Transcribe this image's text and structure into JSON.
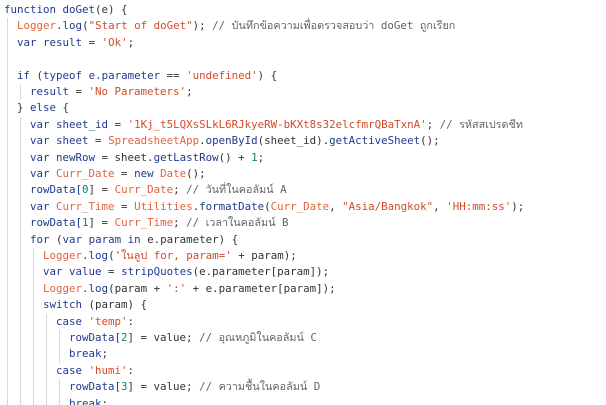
{
  "editor": {
    "lines": [
      [
        {
          "t": "function ",
          "c": "kw"
        },
        {
          "t": "doGet",
          "c": "fn"
        },
        {
          "t": "(e) {",
          "c": "op"
        }
      ],
      [
        {
          "t": "  ",
          "c": "op"
        },
        {
          "t": "Logger",
          "c": "obj"
        },
        {
          "t": ".",
          "c": "op"
        },
        {
          "t": "log",
          "c": "fn"
        },
        {
          "t": "(",
          "c": "op"
        },
        {
          "t": "\"Start of doGet\"",
          "c": "str"
        },
        {
          "t": "); ",
          "c": "op"
        },
        {
          "t": "// บันทึกข้อความเพื่อตรวจสอบว่า doGet ถูกเรียก",
          "c": "cm"
        }
      ],
      [
        {
          "t": "  ",
          "c": "op"
        },
        {
          "t": "var ",
          "c": "kw"
        },
        {
          "t": "result",
          "c": "id"
        },
        {
          "t": " = ",
          "c": "op"
        },
        {
          "t": "'Ok'",
          "c": "str"
        },
        {
          "t": ";",
          "c": "op"
        }
      ],
      [
        {
          "t": "",
          "c": "op"
        }
      ],
      [
        {
          "t": "  ",
          "c": "op"
        },
        {
          "t": "if ",
          "c": "kw"
        },
        {
          "t": "(",
          "c": "op"
        },
        {
          "t": "typeof ",
          "c": "kw"
        },
        {
          "t": "e.parameter",
          "c": "id"
        },
        {
          "t": " == ",
          "c": "op"
        },
        {
          "t": "'undefined'",
          "c": "str"
        },
        {
          "t": ") {",
          "c": "op"
        }
      ],
      [
        {
          "t": "    ",
          "c": "op"
        },
        {
          "t": "result",
          "c": "id"
        },
        {
          "t": " = ",
          "c": "op"
        },
        {
          "t": "'No Parameters'",
          "c": "str"
        },
        {
          "t": ";",
          "c": "op"
        }
      ],
      [
        {
          "t": "  } ",
          "c": "op"
        },
        {
          "t": "else ",
          "c": "kw"
        },
        {
          "t": "{",
          "c": "op"
        }
      ],
      [
        {
          "t": "    ",
          "c": "op"
        },
        {
          "t": "var ",
          "c": "kw"
        },
        {
          "t": "sheet_id",
          "c": "id"
        },
        {
          "t": " = ",
          "c": "op"
        },
        {
          "t": "'1Kj_t5LQXsSLkL6RJkyeRW-bKXt8s32elcfmrQBaTxnA'",
          "c": "str"
        },
        {
          "t": "; ",
          "c": "op"
        },
        {
          "t": "// รหัสสเปรดชีท",
          "c": "cm"
        }
      ],
      [
        {
          "t": "    ",
          "c": "op"
        },
        {
          "t": "var ",
          "c": "kw"
        },
        {
          "t": "sheet",
          "c": "id"
        },
        {
          "t": " = ",
          "c": "op"
        },
        {
          "t": "SpreadsheetApp",
          "c": "obj"
        },
        {
          "t": ".",
          "c": "op"
        },
        {
          "t": "openById",
          "c": "fn"
        },
        {
          "t": "(sheet_id).",
          "c": "op"
        },
        {
          "t": "getActiveSheet",
          "c": "fn"
        },
        {
          "t": "();",
          "c": "op"
        }
      ],
      [
        {
          "t": "    ",
          "c": "op"
        },
        {
          "t": "var ",
          "c": "kw"
        },
        {
          "t": "newRow",
          "c": "id"
        },
        {
          "t": " = sheet.",
          "c": "op"
        },
        {
          "t": "getLastRow",
          "c": "fn"
        },
        {
          "t": "() + ",
          "c": "op"
        },
        {
          "t": "1",
          "c": "num"
        },
        {
          "t": ";",
          "c": "op"
        }
      ],
      [
        {
          "t": "    ",
          "c": "op"
        },
        {
          "t": "var ",
          "c": "kw"
        },
        {
          "t": "Curr_Date",
          "c": "var"
        },
        {
          "t": " = ",
          "c": "op"
        },
        {
          "t": "new ",
          "c": "kw"
        },
        {
          "t": "Date",
          "c": "obj"
        },
        {
          "t": "();",
          "c": "op"
        }
      ],
      [
        {
          "t": "    ",
          "c": "op"
        },
        {
          "t": "rowData[",
          "c": "id"
        },
        {
          "t": "0",
          "c": "num"
        },
        {
          "t": "] = ",
          "c": "op"
        },
        {
          "t": "Curr_Date",
          "c": "var"
        },
        {
          "t": "; ",
          "c": "op"
        },
        {
          "t": "// วันที่ในคอลัมน์ A",
          "c": "cm"
        }
      ],
      [
        {
          "t": "    ",
          "c": "op"
        },
        {
          "t": "var ",
          "c": "kw"
        },
        {
          "t": "Curr_Time",
          "c": "var"
        },
        {
          "t": " = ",
          "c": "op"
        },
        {
          "t": "Utilities",
          "c": "obj"
        },
        {
          "t": ".",
          "c": "op"
        },
        {
          "t": "formatDate",
          "c": "fn"
        },
        {
          "t": "(",
          "c": "op"
        },
        {
          "t": "Curr_Date",
          "c": "var"
        },
        {
          "t": ", ",
          "c": "op"
        },
        {
          "t": "\"Asia/Bangkok\"",
          "c": "str"
        },
        {
          "t": ", ",
          "c": "op"
        },
        {
          "t": "'HH:mm:ss'",
          "c": "str"
        },
        {
          "t": ");",
          "c": "op"
        }
      ],
      [
        {
          "t": "    ",
          "c": "op"
        },
        {
          "t": "rowData[",
          "c": "id"
        },
        {
          "t": "1",
          "c": "num"
        },
        {
          "t": "] = ",
          "c": "op"
        },
        {
          "t": "Curr_Time",
          "c": "var"
        },
        {
          "t": "; ",
          "c": "op"
        },
        {
          "t": "// เวลาในคอลัมน์ B",
          "c": "cm"
        }
      ],
      [
        {
          "t": "    ",
          "c": "op"
        },
        {
          "t": "for ",
          "c": "kw"
        },
        {
          "t": "(",
          "c": "op"
        },
        {
          "t": "var ",
          "c": "kw"
        },
        {
          "t": "param ",
          "c": "id"
        },
        {
          "t": "in ",
          "c": "kw"
        },
        {
          "t": "e.parameter) {",
          "c": "op"
        }
      ],
      [
        {
          "t": "      ",
          "c": "op"
        },
        {
          "t": "Logger",
          "c": "obj"
        },
        {
          "t": ".",
          "c": "op"
        },
        {
          "t": "log",
          "c": "fn"
        },
        {
          "t": "(",
          "c": "op"
        },
        {
          "t": "'ในลูป for, param='",
          "c": "str"
        },
        {
          "t": " + param);",
          "c": "op"
        }
      ],
      [
        {
          "t": "      ",
          "c": "op"
        },
        {
          "t": "var ",
          "c": "kw"
        },
        {
          "t": "value",
          "c": "id"
        },
        {
          "t": " = ",
          "c": "op"
        },
        {
          "t": "stripQuotes",
          "c": "fn"
        },
        {
          "t": "(e.parameter[param]);",
          "c": "op"
        }
      ],
      [
        {
          "t": "      ",
          "c": "op"
        },
        {
          "t": "Logger",
          "c": "obj"
        },
        {
          "t": ".",
          "c": "op"
        },
        {
          "t": "log",
          "c": "fn"
        },
        {
          "t": "(param + ",
          "c": "op"
        },
        {
          "t": "':'",
          "c": "str"
        },
        {
          "t": " + e.parameter[param]);",
          "c": "op"
        }
      ],
      [
        {
          "t": "      ",
          "c": "op"
        },
        {
          "t": "switch ",
          "c": "kw"
        },
        {
          "t": "(param) {",
          "c": "op"
        }
      ],
      [
        {
          "t": "        ",
          "c": "op"
        },
        {
          "t": "case ",
          "c": "kw"
        },
        {
          "t": "'temp'",
          "c": "str"
        },
        {
          "t": ":",
          "c": "op"
        }
      ],
      [
        {
          "t": "          ",
          "c": "op"
        },
        {
          "t": "rowData[",
          "c": "id"
        },
        {
          "t": "2",
          "c": "num"
        },
        {
          "t": "] = value; ",
          "c": "op"
        },
        {
          "t": "// อุณหภูมิในคอลัมน์ C",
          "c": "cm"
        }
      ],
      [
        {
          "t": "          ",
          "c": "op"
        },
        {
          "t": "break",
          "c": "kw"
        },
        {
          "t": ";",
          "c": "op"
        }
      ],
      [
        {
          "t": "        ",
          "c": "op"
        },
        {
          "t": "case ",
          "c": "kw"
        },
        {
          "t": "'humi'",
          "c": "str"
        },
        {
          "t": ":",
          "c": "op"
        }
      ],
      [
        {
          "t": "          ",
          "c": "op"
        },
        {
          "t": "rowData[",
          "c": "id"
        },
        {
          "t": "3",
          "c": "num"
        },
        {
          "t": "] = value; ",
          "c": "op"
        },
        {
          "t": "// ความชื้นในคอลัมน์ D",
          "c": "cm"
        }
      ],
      [
        {
          "t": "          ",
          "c": "op"
        },
        {
          "t": "break",
          "c": "kw"
        },
        {
          "t": ";",
          "c": "op"
        }
      ]
    ]
  }
}
